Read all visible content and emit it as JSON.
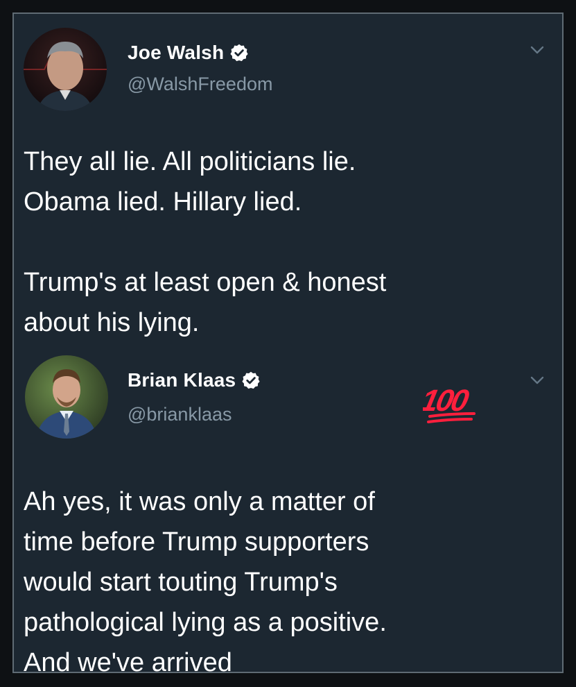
{
  "tweets": [
    {
      "display_name": "Joe Walsh",
      "handle": "@WalshFreedom",
      "verified": true,
      "text": "They all lie. All politicians lie.\nObama lied. Hillary lied.\n\nTrump's at least open & honest\nabout his lying."
    },
    {
      "display_name": "Brian Klaas",
      "handle": "@brianklaas",
      "verified": true,
      "reaction_emoji": "100",
      "text": "Ah yes, it was only a matter of\ntime before Trump supporters\nwould start touting Trump's\npathological lying as a positive.\nAnd we've arrived"
    }
  ],
  "colors": {
    "background": "#1c2731",
    "text": "#ffffff",
    "handle": "#8899a6",
    "emoji": "#ff1f3d"
  },
  "icons": {
    "verified": "verified-badge-icon",
    "menu": "chevron-down-icon",
    "reaction": "hundred-points-emoji-icon"
  }
}
